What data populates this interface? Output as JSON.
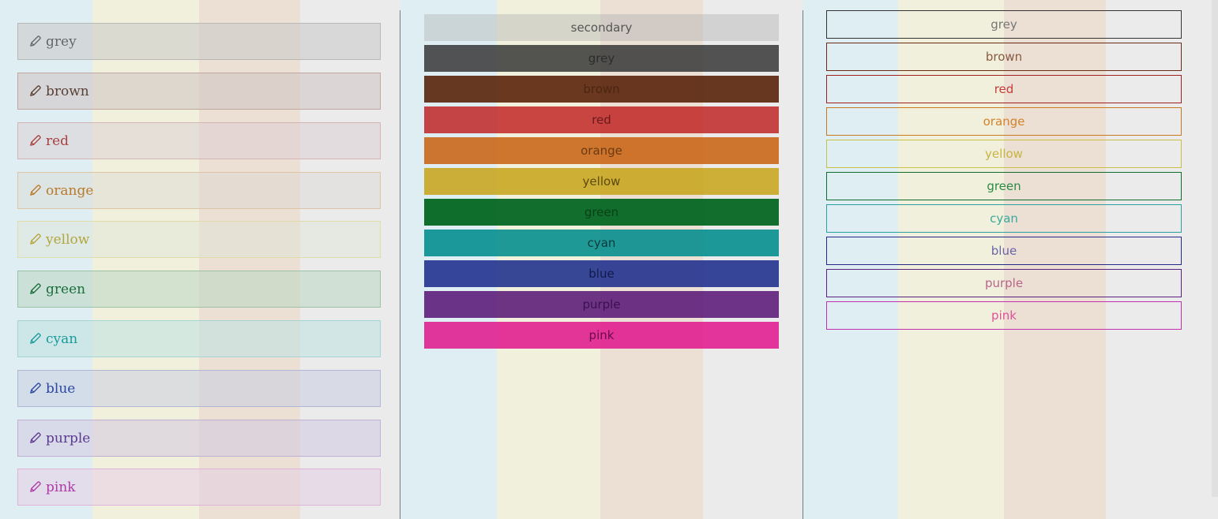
{
  "background_bands": [
    {
      "color": "#dfeef2"
    },
    {
      "color": "#f1f0dc"
    },
    {
      "color": "#ecdfd3"
    },
    {
      "color": "#ebebeb"
    }
  ],
  "left_panel": {
    "icon": "pencil-icon",
    "items": [
      {
        "label": "grey",
        "text_color": "#666666",
        "border": "#b8b8b8",
        "tint": "rgba(200,200,200,0.55)"
      },
      {
        "label": "brown",
        "text_color": "#5a4035",
        "border": "#c0a8a0",
        "tint": "rgba(205,195,195,0.55)"
      },
      {
        "label": "red",
        "text_color": "#a8403f",
        "border": "#d4b5b5",
        "tint": "rgba(220,205,210,0.5)"
      },
      {
        "label": "orange",
        "text_color": "#b97a2a",
        "border": "#dcc4a4",
        "tint": "rgba(220,215,210,0.45)"
      },
      {
        "label": "yellow",
        "text_color": "#b3a53d",
        "border": "#e0dca8",
        "tint": "rgba(225,228,215,0.45)"
      },
      {
        "label": "green",
        "text_color": "#1a6e3a",
        "border": "#9cc2a6",
        "tint": "rgba(185,215,195,0.55)"
      },
      {
        "label": "cyan",
        "text_color": "#1a9a9a",
        "border": "#a6d4d4",
        "tint": "rgba(190,225,225,0.55)"
      },
      {
        "label": "blue",
        "text_color": "#2a48a0",
        "border": "#b0b6d4",
        "tint": "rgba(200,205,225,0.55)"
      },
      {
        "label": "purple",
        "text_color": "#5c3a8e",
        "border": "#c2b0d4",
        "tint": "rgba(210,200,225,0.55)"
      },
      {
        "label": "pink",
        "text_color": "#b03aa8",
        "border": "#e0b4da",
        "tint": "rgba(230,205,230,0.55)"
      }
    ]
  },
  "middle_panel": {
    "items": [
      {
        "label": "secondary",
        "bg": "rgba(180,180,180,0.45)",
        "text_color": "#555555"
      },
      {
        "label": "grey",
        "bg": "rgba(60,60,60,0.88)",
        "text_color": "#2c2c2c"
      },
      {
        "label": "brown",
        "bg": "rgba(90,35,10,0.9)",
        "text_color": "#4a2610"
      },
      {
        "label": "red",
        "bg": "rgba(190,30,30,0.82)",
        "text_color": "#6a1a1a"
      },
      {
        "label": "orange",
        "bg": "rgba(200,100,20,0.88)",
        "text_color": "#6a3a10"
      },
      {
        "label": "yellow",
        "bg": "rgba(200,165,30,0.88)",
        "text_color": "#5a4a10"
      },
      {
        "label": "green",
        "bg": "rgba(0,100,30,0.93)",
        "text_color": "#0c4018"
      },
      {
        "label": "cyan",
        "bg": "rgba(0,140,140,0.88)",
        "text_color": "#0c3a3a"
      },
      {
        "label": "blue",
        "bg": "rgba(30,45,140,0.88)",
        "text_color": "#101a4a"
      },
      {
        "label": "purple",
        "bg": "rgba(90,25,120,0.88)",
        "text_color": "#3a1050"
      },
      {
        "label": "pink",
        "bg": "rgba(225,20,140,0.85)",
        "text_color": "#6a0a4a"
      }
    ]
  },
  "right_panel": {
    "items": [
      {
        "label": "grey",
        "color": "#777777",
        "border": "#333333"
      },
      {
        "label": "brown",
        "color": "#8a5a40",
        "border": "#6a2a14"
      },
      {
        "label": "red",
        "color": "#c83a3a",
        "border": "#a02020"
      },
      {
        "label": "orange",
        "color": "#d4822a",
        "border": "#c87a1e"
      },
      {
        "label": "yellow",
        "color": "#c8b440",
        "border": "#c8c048"
      },
      {
        "label": "green",
        "color": "#2a8a44",
        "border": "#0e6e2c"
      },
      {
        "label": "cyan",
        "color": "#3aaa9c",
        "border": "#2aa0a0"
      },
      {
        "label": "blue",
        "color": "#6a64a8",
        "border": "#23288a"
      },
      {
        "label": "purple",
        "color": "#b8648a",
        "border": "#5a2080"
      },
      {
        "label": "pink",
        "color": "#e0509a",
        "border": "#c030b0"
      }
    ]
  }
}
